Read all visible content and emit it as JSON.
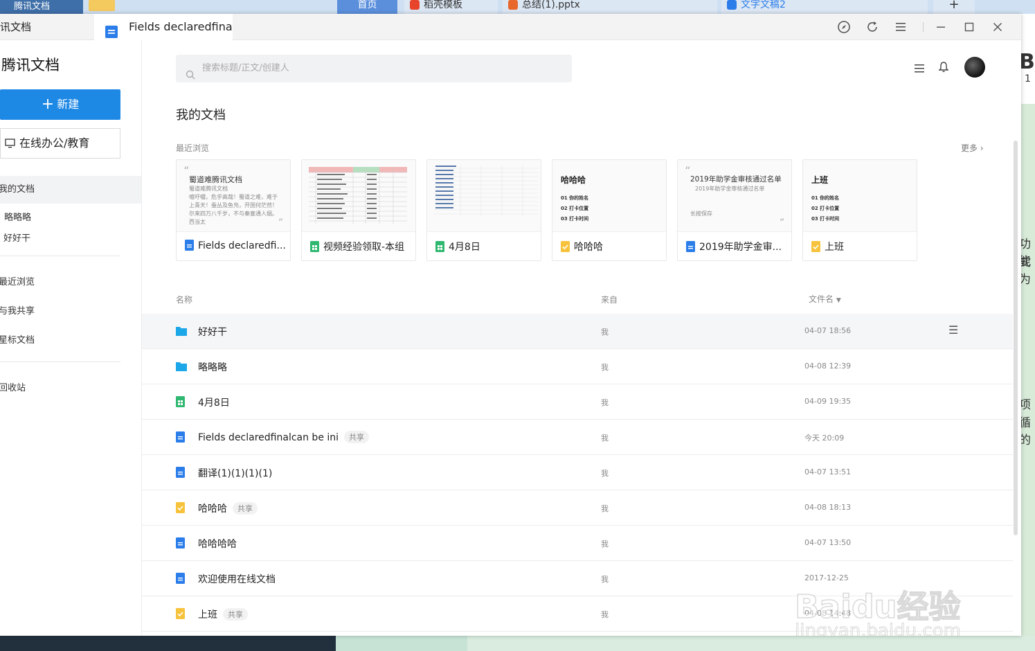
{
  "background": {
    "desktop_tab": "腾讯文档",
    "browser_tabs": [
      {
        "label": "首页"
      },
      {
        "label": "稻壳模板"
      },
      {
        "label": "总结(1).pptx"
      },
      {
        "label": "文字文稿2"
      }
    ],
    "right_peek": [
      "Bl",
      "1",
      "功能",
      "式为",
      "项",
      "循的"
    ]
  },
  "titlebar": {
    "app_name": "讯文档",
    "tab_title": "Fields declaredfinal"
  },
  "sidebar": {
    "brand": "腾讯文档",
    "new_button": "新建",
    "edu_button": "在线办公/教育",
    "items": [
      {
        "label": "我的文档"
      },
      {
        "label": "略略略"
      },
      {
        "label": "好好干"
      },
      {
        "label": "最近浏览"
      },
      {
        "label": "与我共享"
      },
      {
        "label": "星标文档"
      },
      {
        "label": "回收站"
      }
    ]
  },
  "header": {
    "search_placeholder": "搜索标题/正文/创建人"
  },
  "main": {
    "title": "我的文档",
    "recent_label": "最近浏览",
    "more_label": "更多",
    "cards": [
      {
        "name": "Fields declaredfi...",
        "type": "doc",
        "thumb_title": "蜀道难腾讯文档",
        "thumb_sub": "蜀道难腾讯文档",
        "thumb_body": "噫吁嚱，危乎高哉！蜀道之难，难于上青天！蚕丛及鱼凫，开国何茫然！尔来四万八千岁，不与秦塞通人烟。西当太"
      },
      {
        "name": "视频经验领取-本组",
        "type": "sheet"
      },
      {
        "name": "4月8日",
        "type": "sheet"
      },
      {
        "name": "哈哈哈",
        "type": "form",
        "thumb_title": "哈哈哈",
        "thumb_list": [
          "01  你的姓名",
          "02  打卡位置",
          "03  打卡时间"
        ]
      },
      {
        "name": "2019年助学金审...",
        "type": "doc",
        "thumb_title": "2019年助学金审核通过名单",
        "thumb_sub": "2019年助学金审核通过名单",
        "thumb_body": "长按保存"
      },
      {
        "name": "上班",
        "type": "form",
        "thumb_title": "上班",
        "thumb_list": [
          "01  你的姓名",
          "02  打卡位置",
          "03  打卡时间"
        ]
      }
    ],
    "columns": {
      "name": "名称",
      "from": "来自",
      "sort": "文件名"
    },
    "rows": [
      {
        "name": "好好干",
        "type": "folder",
        "tag": "",
        "from": "我",
        "time": "04-07 18:56"
      },
      {
        "name": "略略略",
        "type": "folder",
        "tag": "",
        "from": "我",
        "time": "04-08 12:39"
      },
      {
        "name": "4月8日",
        "type": "sheet",
        "tag": "",
        "from": "我",
        "time": "04-09 19:35"
      },
      {
        "name": "Fields declaredfinalcan be ini",
        "type": "doc",
        "tag": "共享",
        "from": "我",
        "time": "今天 20:09"
      },
      {
        "name": "翻译(1)(1)(1)(1)",
        "type": "doc",
        "tag": "",
        "from": "我",
        "time": "04-07 13:51"
      },
      {
        "name": "哈哈哈",
        "type": "form",
        "tag": "共享",
        "from": "我",
        "time": "04-08 18:13"
      },
      {
        "name": "哈哈哈哈",
        "type": "doc",
        "tag": "",
        "from": "我",
        "time": "04-07 13:50"
      },
      {
        "name": "欢迎使用在线文档",
        "type": "doc",
        "tag": "",
        "from": "我",
        "time": "2017-12-25"
      },
      {
        "name": "上班",
        "type": "form",
        "tag": "共享",
        "from": "我",
        "time": "04-08 14:48"
      }
    ]
  },
  "watermark": {
    "text": "Baidu经验",
    "url": "jingyan.baidu.com"
  },
  "colors": {
    "accent": "#1e88e5",
    "folder": "#1ba7e8",
    "sheet": "#2fb870",
    "form": "#f7c33c",
    "doc": "#2b7de9"
  }
}
